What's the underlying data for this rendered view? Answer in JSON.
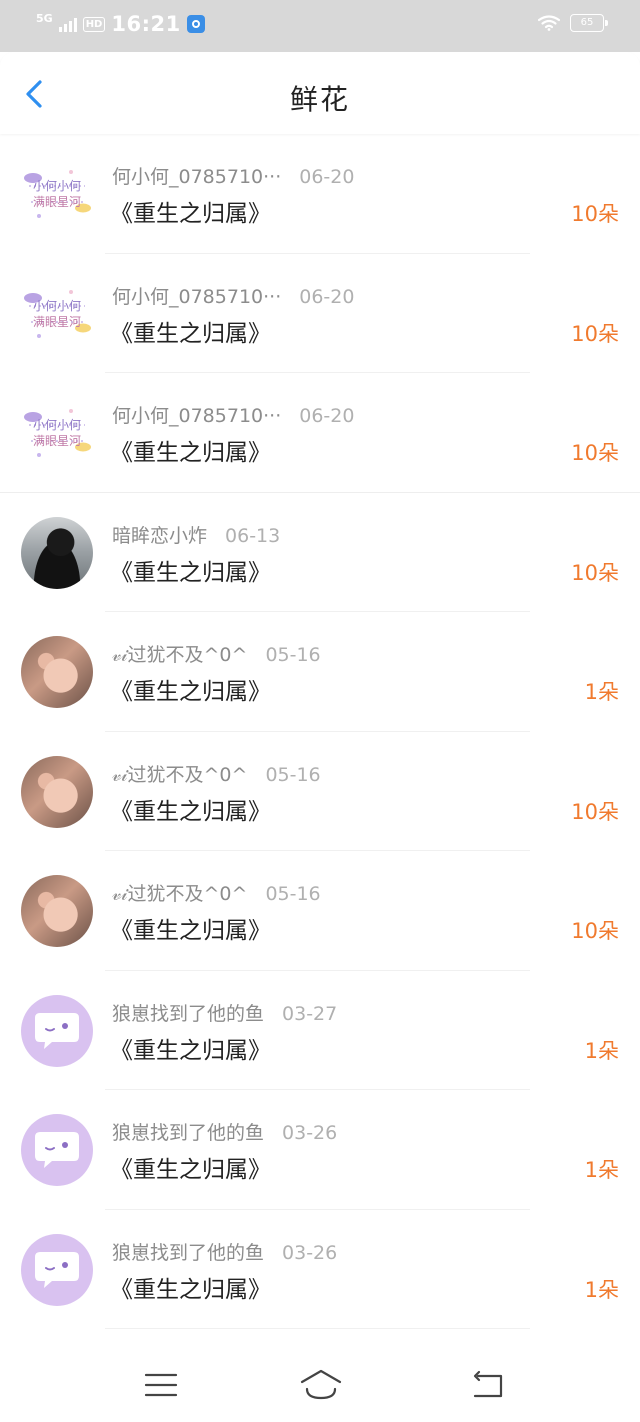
{
  "status_bar": {
    "network": "5G",
    "hd": "HD",
    "time": "16:21",
    "battery": "65"
  },
  "header": {
    "title": "鲜花"
  },
  "gifts": [
    {
      "avatar": "sticker",
      "user": "何小何_0785710···",
      "date": "06-20",
      "book": "《重生之归属》",
      "count": "10朵"
    },
    {
      "avatar": "sticker",
      "user": "何小何_0785710···",
      "date": "06-20",
      "book": "《重生之归属》",
      "count": "10朵"
    },
    {
      "avatar": "sticker",
      "user": "何小何_0785710···",
      "date": "06-20",
      "book": "《重生之归属》",
      "count": "10朵"
    },
    {
      "avatar": "dark",
      "user": "暗眸恋小炸",
      "date": "06-13",
      "book": "《重生之归属》",
      "count": "10朵"
    },
    {
      "avatar": "pig",
      "user": "𝓋𝒾过犹不及^0^",
      "date": "05-16",
      "book": "《重生之归属》",
      "count": "1朵"
    },
    {
      "avatar": "pig",
      "user": "𝓋𝒾过犹不及^0^",
      "date": "05-16",
      "book": "《重生之归属》",
      "count": "10朵"
    },
    {
      "avatar": "pig",
      "user": "𝓋𝒾过犹不及^0^",
      "date": "05-16",
      "book": "《重生之归属》",
      "count": "10朵"
    },
    {
      "avatar": "bubble",
      "user": "狼崽找到了他的鱼",
      "date": "03-27",
      "book": "《重生之归属》",
      "count": "1朵"
    },
    {
      "avatar": "bubble",
      "user": "狼崽找到了他的鱼",
      "date": "03-26",
      "book": "《重生之归属》",
      "count": "1朵"
    },
    {
      "avatar": "bubble",
      "user": "狼崽找到了他的鱼",
      "date": "03-26",
      "book": "《重生之归属》",
      "count": "1朵"
    }
  ],
  "colors": {
    "accent_back": "#2f8ff0",
    "flower_count": "#f07a2e",
    "status_bar_bg": "#d8d8d8"
  },
  "icons": {
    "back": "chevron-left-icon",
    "menu": "menu-icon",
    "home": "home-icon",
    "return": "return-icon"
  }
}
